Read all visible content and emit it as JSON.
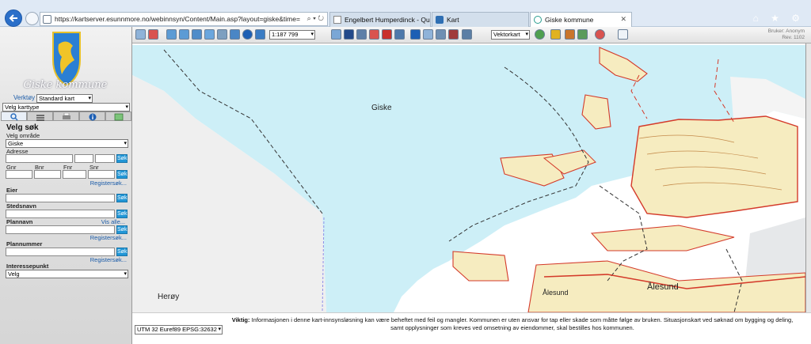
{
  "browser": {
    "url": "https://kartserver.esunnmore.no/webinnsyn/Content/Main.asp?layout=giske&time=143522",
    "url_tools": "⌕ ▾ ↻",
    "tabs": [
      {
        "label": "Engelbert Humperdinck - Qua..."
      },
      {
        "label": "Kart"
      },
      {
        "label": "Giske kommune",
        "close": "✕"
      }
    ],
    "window_icons": "⌂ ★ ⚙"
  },
  "sidebar": {
    "municipality": "Giske kommune",
    "verktoy_label": "Verktøy",
    "verktoy_value": "Standard kart",
    "karttype_value": "Velg karttype",
    "search": {
      "heading": "Velg søk",
      "omrade_label": "Velg område",
      "omrade_value": "Giske",
      "adresse_label": "Adresse",
      "gnr_label": "Gnr",
      "bnr_label": "Bnr",
      "fnr_label": "Fnr",
      "snr_label": "Snr",
      "eier_label": "Eier",
      "stedsnavn_label": "Stedsnavn",
      "plannavn_label": "Plannavn",
      "plannummer_label": "Plannummer",
      "interessepunkt_label": "Interessepunkt",
      "interessepunkt_value": "Velg",
      "sok_button": "Søk",
      "registersok_link": "Registersøk...",
      "vis_alle_link": "Vis alle..."
    }
  },
  "toolbar": {
    "scale_value": "1:187 799",
    "maptype_value": "Vektorkart",
    "user_label": "Bruker: Anonym",
    "rev_label": "Rev. 1102"
  },
  "map": {
    "labels": {
      "giske": "Giske",
      "heroy": "Herøy",
      "alesund_small": "Ålesund",
      "alesund_large": "Ålesund"
    },
    "colors": {
      "sea": "#cdeff7",
      "land": "#f6ecc0",
      "contour": "#c48a4a",
      "road": "#d43a2a",
      "border": "#333333"
    }
  },
  "footer": {
    "note_bold": "Viktig:",
    "note_text": "Informasjonen i denne kart-innsynsløsning kan være beheftet med feil og mangler. Kommunen er uten ansvar for tap eller skade som måtte følge av bruken. Situasjonskart ved søknad om bygging og deling, samt opplysninger som kreves ved omsetning av eiendommer, skal bestilles hos kommunen.",
    "projection_value": "UTM 32 Euref89 EPSG:32632"
  }
}
